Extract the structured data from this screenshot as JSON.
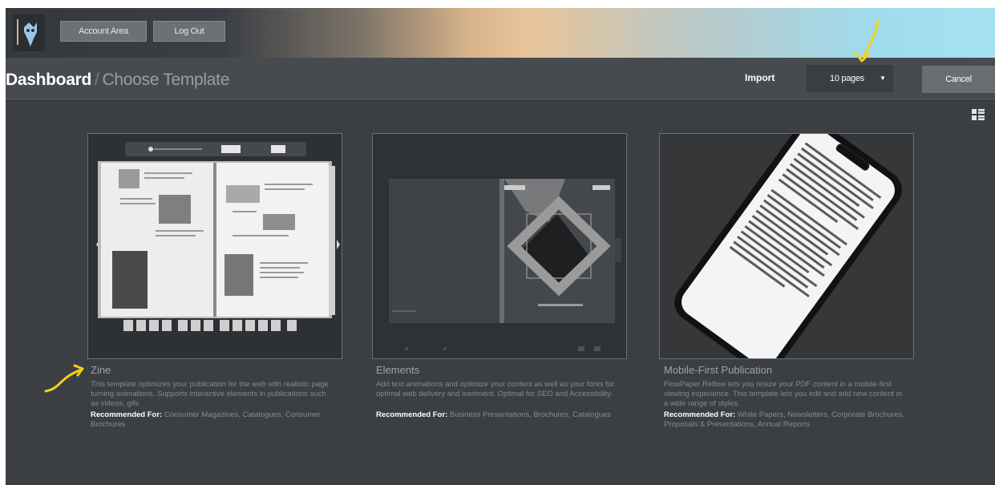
{
  "topbar": {
    "account_label": "Account Area",
    "logout_label": "Log Out"
  },
  "header": {
    "breadcrumb_home": "Dashboard",
    "breadcrumb_sep": "/",
    "breadcrumb_current": "Choose Template",
    "import_label": "Import",
    "pages_value": "10 pages",
    "cancel_label": "Cancel"
  },
  "templates": [
    {
      "title": "Zine",
      "description": "This template optimizes your publication for the web with realistic page turning animations. Supports interactive elements in publications such as videos, gifs",
      "rec_label": "Recommended For:",
      "rec_value": "Consumer Magazines, Catalogues, Consumer Brochures"
    },
    {
      "title": "Elements",
      "description": "Add text animations and optimize your content as well as your fonts for optimal web delivery and ineriment. Optimal for SEO and Accessibility.",
      "rec_label": "Recommended For:",
      "rec_value": "Business Presentations, Brochures, Catalogues"
    },
    {
      "title": "Mobile-First Publication",
      "description": "FlowPaper Reflow lets you resize your PDF content in a mobile-first viewing experience. This template lets you edit and add new content in a wide range of styles.",
      "rec_label": "Recommended For:",
      "rec_value": "White Papers, Newsletters, Corporate Brochures, Proposals & Presentations, Annual Reports"
    }
  ],
  "colors": {
    "accent_annotation": "#f2d21b",
    "background": "#3b3f43"
  }
}
